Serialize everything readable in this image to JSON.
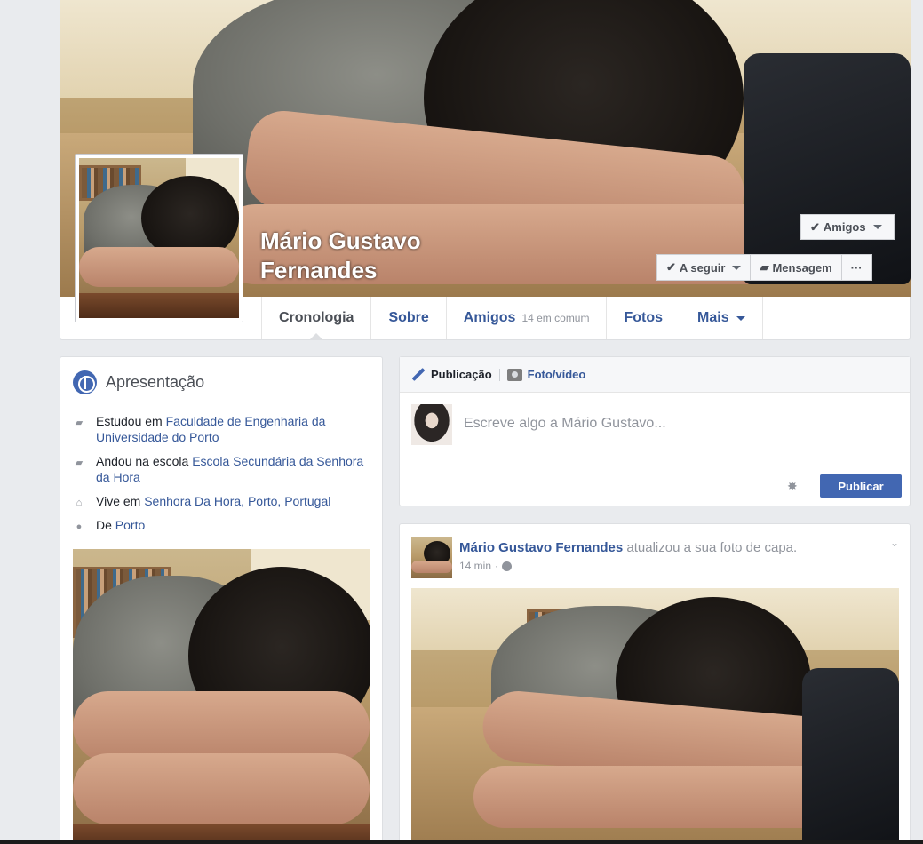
{
  "profile": {
    "name": "Mário Gustavo Fernandes"
  },
  "cover_buttons": {
    "friends": "Amigos",
    "following": "A seguir",
    "message": "Mensagem",
    "more": "···"
  },
  "tabs": [
    {
      "label": "Cronologia",
      "sub": ""
    },
    {
      "label": "Sobre",
      "sub": ""
    },
    {
      "label": "Amigos",
      "sub": "14 em comum"
    },
    {
      "label": "Fotos",
      "sub": ""
    },
    {
      "label": "Mais",
      "sub": ""
    }
  ],
  "intro": {
    "title": "Apresentação",
    "rows": [
      {
        "prefix": "Estudou em ",
        "link": "Faculdade de Engenharia da Universidade do Porto",
        "icon": "graduation-cap-icon"
      },
      {
        "prefix": "Andou na escola ",
        "link": "Escola Secundária da Senhora da Hora",
        "icon": "graduation-cap-icon"
      },
      {
        "prefix": "Vive em ",
        "link": "Senhora Da Hora, Porto, Portugal",
        "icon": "home-icon"
      },
      {
        "prefix": "De ",
        "link": "Porto",
        "icon": "location-pin-icon"
      }
    ]
  },
  "composer": {
    "tab_post": "Publicação",
    "tab_photo": "Foto/vídeo",
    "placeholder": "Escreve algo a Mário Gustavo...",
    "publish": "Publicar"
  },
  "post": {
    "author": "Mário Gustavo Fernandes",
    "action": " atualizou a sua foto de capa.",
    "time": "14 min",
    "dot": "·"
  },
  "colors": {
    "link": "#365899",
    "primary_button": "#4267b2",
    "background": "#e9ebee"
  }
}
